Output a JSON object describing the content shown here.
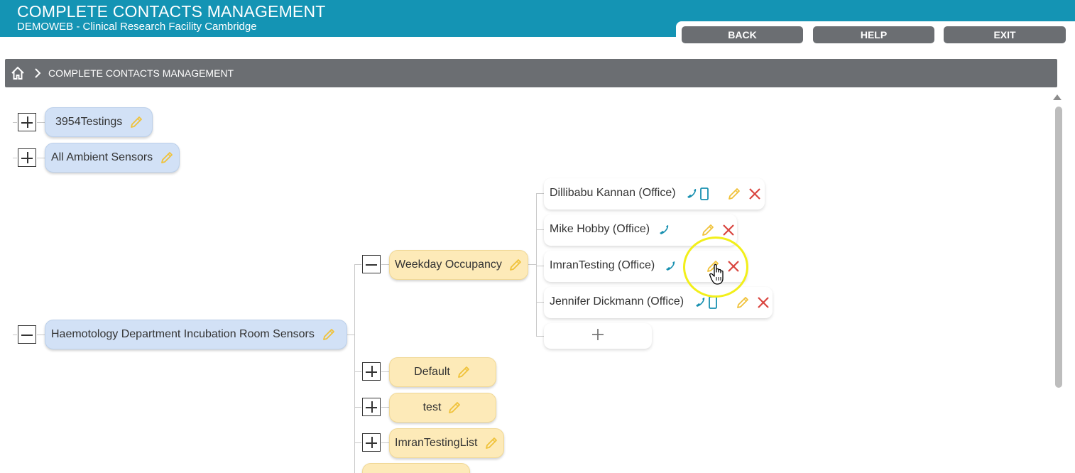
{
  "header": {
    "title": "COMPLETE CONTACTS MANAGEMENT",
    "subtitle": "DEMOWEB - Clinical Research Facility Cambridge",
    "buttons": {
      "back": "BACK",
      "help": "HELP",
      "exit": "EXIT"
    }
  },
  "breadcrumb": {
    "current": "COMPLETE CONTACTS MANAGEMENT"
  },
  "tree": {
    "groups": [
      {
        "label": "3954Testings",
        "expanded": false
      },
      {
        "label": "All Ambient Sensors",
        "expanded": false
      },
      {
        "label": "Haemotology Department Incubation Room Sensors",
        "expanded": true
      }
    ],
    "schedules": [
      {
        "label": "Weekday Occupancy",
        "expanded": true
      },
      {
        "label": "Default",
        "expanded": false
      },
      {
        "label": "test",
        "expanded": false
      },
      {
        "label": "ImranTestingList",
        "expanded": false
      }
    ],
    "contacts": [
      {
        "label": "Dillibabu Kannan (Office)",
        "icons": [
          "phone-icon",
          "mobile-icon"
        ]
      },
      {
        "label": "Mike Hobby (Office)",
        "icons": [
          "phone-icon"
        ]
      },
      {
        "label": "ImranTesting (Office)",
        "icons": [
          "phone-icon"
        ]
      },
      {
        "label": "Jennifer Dickmann (Office)",
        "icons": [
          "phone-icon",
          "mobile-icon"
        ]
      }
    ],
    "add_contact_symbol": "+"
  },
  "colors": {
    "header": "#1494b4",
    "button": "#6b6e72",
    "group_node": "#d2e1f6",
    "schedule_node": "#fdeab8",
    "pencil": "#f0c23a",
    "delete": "#d9453f",
    "phone": "#1890b0",
    "highlight": "#f2ef1a"
  }
}
